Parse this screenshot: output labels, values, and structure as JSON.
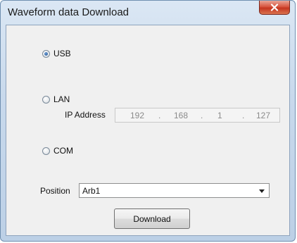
{
  "window": {
    "title": "Waveform data Download"
  },
  "interface": {
    "options": [
      {
        "label": "USB",
        "checked": true
      },
      {
        "label": "LAN",
        "checked": false
      },
      {
        "label": "COM",
        "checked": false
      }
    ]
  },
  "ip": {
    "label": "IP Address",
    "octets": [
      "192",
      "168",
      "1",
      "127"
    ]
  },
  "position": {
    "label": "Position",
    "value": "Arb1"
  },
  "download_label": "Download",
  "icons": {
    "close": "close-icon",
    "dropdown": "chevron-down-icon"
  }
}
